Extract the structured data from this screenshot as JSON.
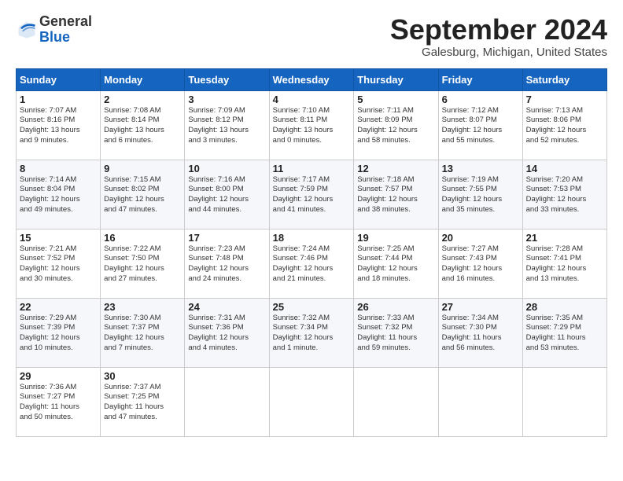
{
  "header": {
    "logo_general": "General",
    "logo_blue": "Blue",
    "title": "September 2024",
    "location": "Galesburg, Michigan, United States"
  },
  "columns": [
    "Sunday",
    "Monday",
    "Tuesday",
    "Wednesday",
    "Thursday",
    "Friday",
    "Saturday"
  ],
  "weeks": [
    [
      {
        "day": "1",
        "lines": [
          "Sunrise: 7:07 AM",
          "Sunset: 8:16 PM",
          "Daylight: 13 hours",
          "and 9 minutes."
        ]
      },
      {
        "day": "2",
        "lines": [
          "Sunrise: 7:08 AM",
          "Sunset: 8:14 PM",
          "Daylight: 13 hours",
          "and 6 minutes."
        ]
      },
      {
        "day": "3",
        "lines": [
          "Sunrise: 7:09 AM",
          "Sunset: 8:12 PM",
          "Daylight: 13 hours",
          "and 3 minutes."
        ]
      },
      {
        "day": "4",
        "lines": [
          "Sunrise: 7:10 AM",
          "Sunset: 8:11 PM",
          "Daylight: 13 hours",
          "and 0 minutes."
        ]
      },
      {
        "day": "5",
        "lines": [
          "Sunrise: 7:11 AM",
          "Sunset: 8:09 PM",
          "Daylight: 12 hours",
          "and 58 minutes."
        ]
      },
      {
        "day": "6",
        "lines": [
          "Sunrise: 7:12 AM",
          "Sunset: 8:07 PM",
          "Daylight: 12 hours",
          "and 55 minutes."
        ]
      },
      {
        "day": "7",
        "lines": [
          "Sunrise: 7:13 AM",
          "Sunset: 8:06 PM",
          "Daylight: 12 hours",
          "and 52 minutes."
        ]
      }
    ],
    [
      {
        "day": "8",
        "lines": [
          "Sunrise: 7:14 AM",
          "Sunset: 8:04 PM",
          "Daylight: 12 hours",
          "and 49 minutes."
        ]
      },
      {
        "day": "9",
        "lines": [
          "Sunrise: 7:15 AM",
          "Sunset: 8:02 PM",
          "Daylight: 12 hours",
          "and 47 minutes."
        ]
      },
      {
        "day": "10",
        "lines": [
          "Sunrise: 7:16 AM",
          "Sunset: 8:00 PM",
          "Daylight: 12 hours",
          "and 44 minutes."
        ]
      },
      {
        "day": "11",
        "lines": [
          "Sunrise: 7:17 AM",
          "Sunset: 7:59 PM",
          "Daylight: 12 hours",
          "and 41 minutes."
        ]
      },
      {
        "day": "12",
        "lines": [
          "Sunrise: 7:18 AM",
          "Sunset: 7:57 PM",
          "Daylight: 12 hours",
          "and 38 minutes."
        ]
      },
      {
        "day": "13",
        "lines": [
          "Sunrise: 7:19 AM",
          "Sunset: 7:55 PM",
          "Daylight: 12 hours",
          "and 35 minutes."
        ]
      },
      {
        "day": "14",
        "lines": [
          "Sunrise: 7:20 AM",
          "Sunset: 7:53 PM",
          "Daylight: 12 hours",
          "and 33 minutes."
        ]
      }
    ],
    [
      {
        "day": "15",
        "lines": [
          "Sunrise: 7:21 AM",
          "Sunset: 7:52 PM",
          "Daylight: 12 hours",
          "and 30 minutes."
        ]
      },
      {
        "day": "16",
        "lines": [
          "Sunrise: 7:22 AM",
          "Sunset: 7:50 PM",
          "Daylight: 12 hours",
          "and 27 minutes."
        ]
      },
      {
        "day": "17",
        "lines": [
          "Sunrise: 7:23 AM",
          "Sunset: 7:48 PM",
          "Daylight: 12 hours",
          "and 24 minutes."
        ]
      },
      {
        "day": "18",
        "lines": [
          "Sunrise: 7:24 AM",
          "Sunset: 7:46 PM",
          "Daylight: 12 hours",
          "and 21 minutes."
        ]
      },
      {
        "day": "19",
        "lines": [
          "Sunrise: 7:25 AM",
          "Sunset: 7:44 PM",
          "Daylight: 12 hours",
          "and 18 minutes."
        ]
      },
      {
        "day": "20",
        "lines": [
          "Sunrise: 7:27 AM",
          "Sunset: 7:43 PM",
          "Daylight: 12 hours",
          "and 16 minutes."
        ]
      },
      {
        "day": "21",
        "lines": [
          "Sunrise: 7:28 AM",
          "Sunset: 7:41 PM",
          "Daylight: 12 hours",
          "and 13 minutes."
        ]
      }
    ],
    [
      {
        "day": "22",
        "lines": [
          "Sunrise: 7:29 AM",
          "Sunset: 7:39 PM",
          "Daylight: 12 hours",
          "and 10 minutes."
        ]
      },
      {
        "day": "23",
        "lines": [
          "Sunrise: 7:30 AM",
          "Sunset: 7:37 PM",
          "Daylight: 12 hours",
          "and 7 minutes."
        ]
      },
      {
        "day": "24",
        "lines": [
          "Sunrise: 7:31 AM",
          "Sunset: 7:36 PM",
          "Daylight: 12 hours",
          "and 4 minutes."
        ]
      },
      {
        "day": "25",
        "lines": [
          "Sunrise: 7:32 AM",
          "Sunset: 7:34 PM",
          "Daylight: 12 hours",
          "and 1 minute."
        ]
      },
      {
        "day": "26",
        "lines": [
          "Sunrise: 7:33 AM",
          "Sunset: 7:32 PM",
          "Daylight: 11 hours",
          "and 59 minutes."
        ]
      },
      {
        "day": "27",
        "lines": [
          "Sunrise: 7:34 AM",
          "Sunset: 7:30 PM",
          "Daylight: 11 hours",
          "and 56 minutes."
        ]
      },
      {
        "day": "28",
        "lines": [
          "Sunrise: 7:35 AM",
          "Sunset: 7:29 PM",
          "Daylight: 11 hours",
          "and 53 minutes."
        ]
      }
    ],
    [
      {
        "day": "29",
        "lines": [
          "Sunrise: 7:36 AM",
          "Sunset: 7:27 PM",
          "Daylight: 11 hours",
          "and 50 minutes."
        ]
      },
      {
        "day": "30",
        "lines": [
          "Sunrise: 7:37 AM",
          "Sunset: 7:25 PM",
          "Daylight: 11 hours",
          "and 47 minutes."
        ]
      },
      null,
      null,
      null,
      null,
      null
    ]
  ]
}
